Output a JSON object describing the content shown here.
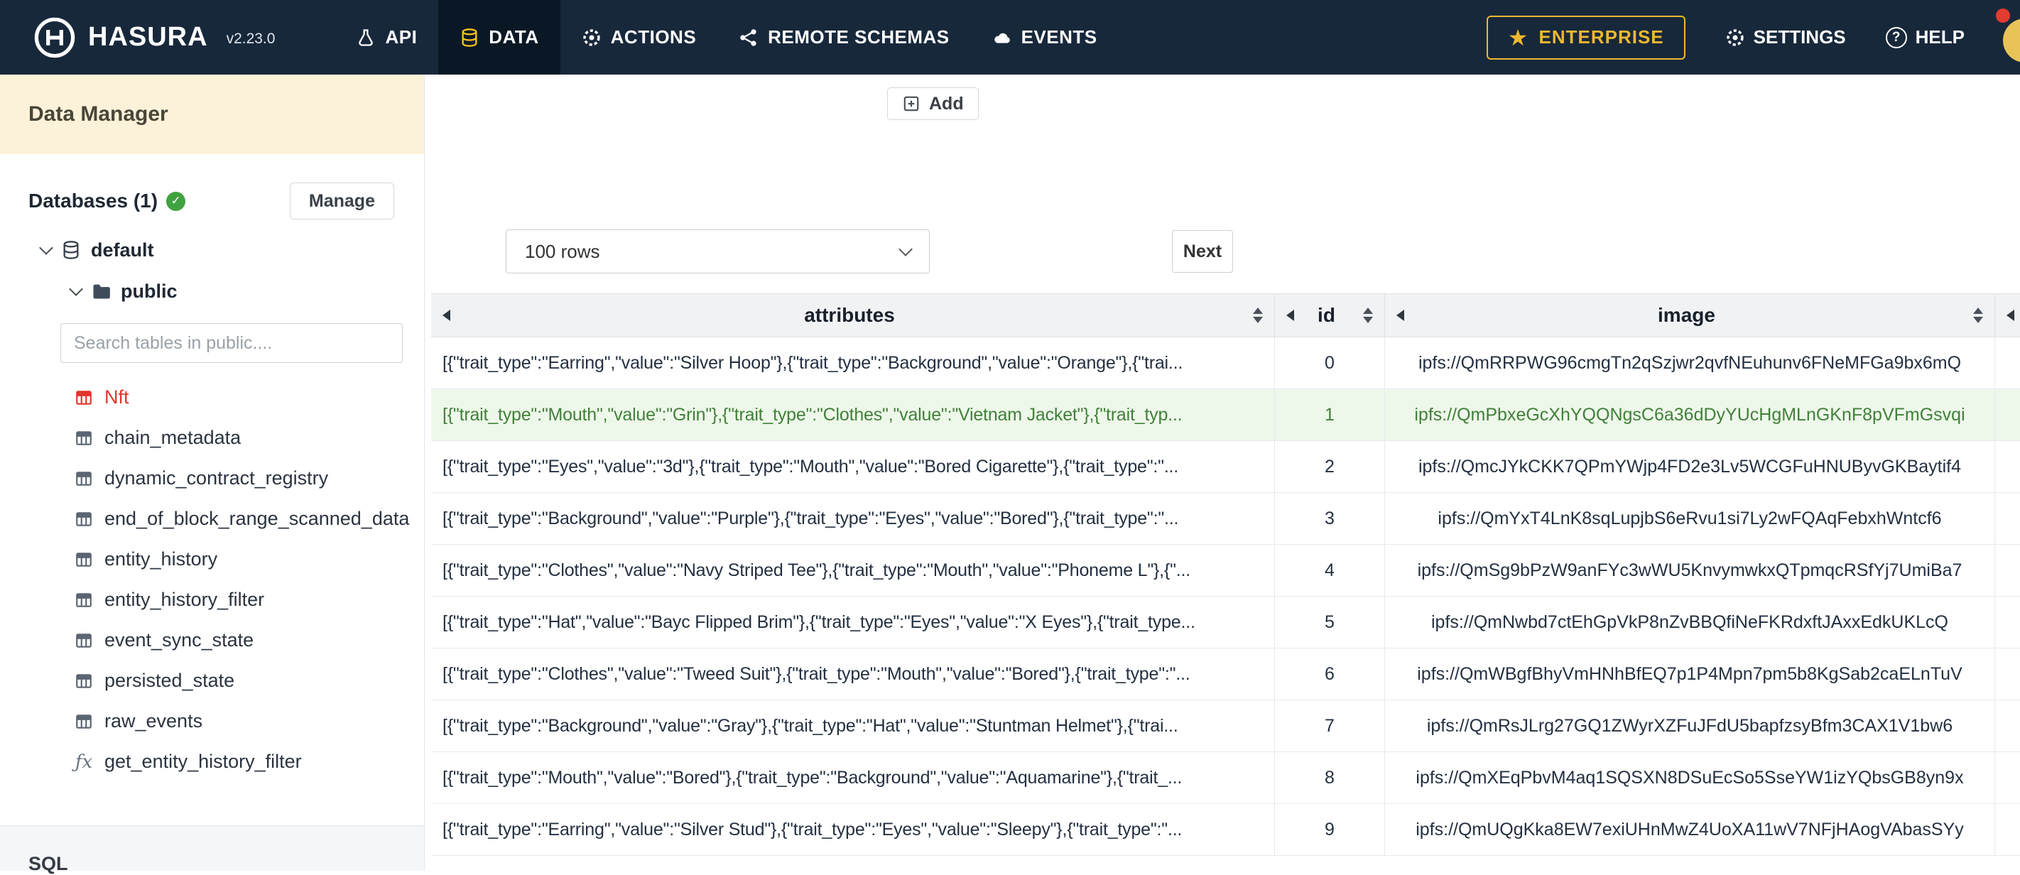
{
  "colors": {
    "navbar_bg": "#18283b",
    "active_tab_bg": "#0a1826",
    "gold": "#edb82f",
    "sidebar_band": "#fbf2d9",
    "red": "#e0362c",
    "green_check": "#3fa23f",
    "row_green_bg": "#eef8ea",
    "row_green_text": "#41803a",
    "header_bg": "#f0f2f4"
  },
  "icons": {
    "star": "★",
    "check": "✓",
    "question": "?",
    "fx": "ƒx"
  },
  "navbar": {
    "brand": "HASURA",
    "version": "v2.23.0",
    "items": [
      {
        "label": "API"
      },
      {
        "label": "DATA"
      },
      {
        "label": "ACTIONS"
      },
      {
        "label": "REMOTE SCHEMAS"
      },
      {
        "label": "EVENTS"
      }
    ],
    "enterprise_label": "ENTERPRISE",
    "settings_label": "SETTINGS",
    "help_label": "HELP"
  },
  "sidebar": {
    "title": "Data Manager",
    "databases_label": "Databases (1)",
    "manage_button": "Manage",
    "tree": {
      "database": "default",
      "schema": "public"
    },
    "search_placeholder": "Search tables in public....",
    "tables": [
      "Nft",
      "chain_metadata",
      "dynamic_contract_registry",
      "end_of_block_range_scanned_data",
      "entity_history",
      "entity_history_filter",
      "event_sync_state",
      "persisted_state",
      "raw_events"
    ],
    "function_item": "get_entity_history_filter",
    "sql_label": "SQL"
  },
  "toolbar": {
    "add_label": "Add",
    "rows_select_value": "100 rows",
    "next_label": "Next"
  },
  "table": {
    "columns": {
      "attributes": "attributes",
      "id": "id",
      "image": "image"
    },
    "rows": [
      {
        "attributes": "[{\"trait_type\":\"Earring\",\"value\":\"Silver Hoop\"},{\"trait_type\":\"Background\",\"value\":\"Orange\"},{\"trai...",
        "id": "0",
        "image": "ipfs://QmRRPWG96cmgTn2qSzjwr2qvfNEuhunv6FNeMFGa9bx6mQ"
      },
      {
        "attributes": "[{\"trait_type\":\"Mouth\",\"value\":\"Grin\"},{\"trait_type\":\"Clothes\",\"value\":\"Vietnam Jacket\"},{\"trait_typ...",
        "id": "1",
        "image": "ipfs://QmPbxeGcXhYQQNgsC6a36dDyYUcHgMLnGKnF8pVFmGsvqi"
      },
      {
        "attributes": "[{\"trait_type\":\"Eyes\",\"value\":\"3d\"},{\"trait_type\":\"Mouth\",\"value\":\"Bored Cigarette\"},{\"trait_type\":\"...",
        "id": "2",
        "image": "ipfs://QmcJYkCKK7QPmYWjp4FD2e3Lv5WCGFuHNUByvGKBaytif4"
      },
      {
        "attributes": "[{\"trait_type\":\"Background\",\"value\":\"Purple\"},{\"trait_type\":\"Eyes\",\"value\":\"Bored\"},{\"trait_type\":\"...",
        "id": "3",
        "image": "ipfs://QmYxT4LnK8sqLupjbS6eRvu1si7Ly2wFQAqFebxhWntcf6"
      },
      {
        "attributes": "[{\"trait_type\":\"Clothes\",\"value\":\"Navy Striped Tee\"},{\"trait_type\":\"Mouth\",\"value\":\"Phoneme L\"},{\"...",
        "id": "4",
        "image": "ipfs://QmSg9bPzW9anFYc3wWU5KnvymwkxQTpmqcRSfYj7UmiBa7"
      },
      {
        "attributes": "[{\"trait_type\":\"Hat\",\"value\":\"Bayc Flipped Brim\"},{\"trait_type\":\"Eyes\",\"value\":\"X Eyes\"},{\"trait_type...",
        "id": "5",
        "image": "ipfs://QmNwbd7ctEhGpVkP8nZvBBQfiNeFKRdxftJAxxEdkUKLcQ"
      },
      {
        "attributes": "[{\"trait_type\":\"Clothes\",\"value\":\"Tweed Suit\"},{\"trait_type\":\"Mouth\",\"value\":\"Bored\"},{\"trait_type\":\"...",
        "id": "6",
        "image": "ipfs://QmWBgfBhyVmHNhBfEQ7p1P4Mpn7pm5b8KgSab2caELnTuV"
      },
      {
        "attributes": "[{\"trait_type\":\"Background\",\"value\":\"Gray\"},{\"trait_type\":\"Hat\",\"value\":\"Stuntman Helmet\"},{\"trai...",
        "id": "7",
        "image": "ipfs://QmRsJLrg27GQ1ZWyrXZFuJFdU5bapfzsyBfm3CAX1V1bw6"
      },
      {
        "attributes": "[{\"trait_type\":\"Mouth\",\"value\":\"Bored\"},{\"trait_type\":\"Background\",\"value\":\"Aquamarine\"},{\"trait_...",
        "id": "8",
        "image": "ipfs://QmXEqPbvM4aq1SQSXN8DSuEcSo5SseYW1izYQbsGB8yn9x"
      },
      {
        "attributes": "[{\"trait_type\":\"Earring\",\"value\":\"Silver Stud\"},{\"trait_type\":\"Eyes\",\"value\":\"Sleepy\"},{\"trait_type\":\"...",
        "id": "9",
        "image": "ipfs://QmUQgKka8EW7exiUHnMwZ4UoXA11wV7NFjHAogVAbasSYy"
      }
    ]
  }
}
